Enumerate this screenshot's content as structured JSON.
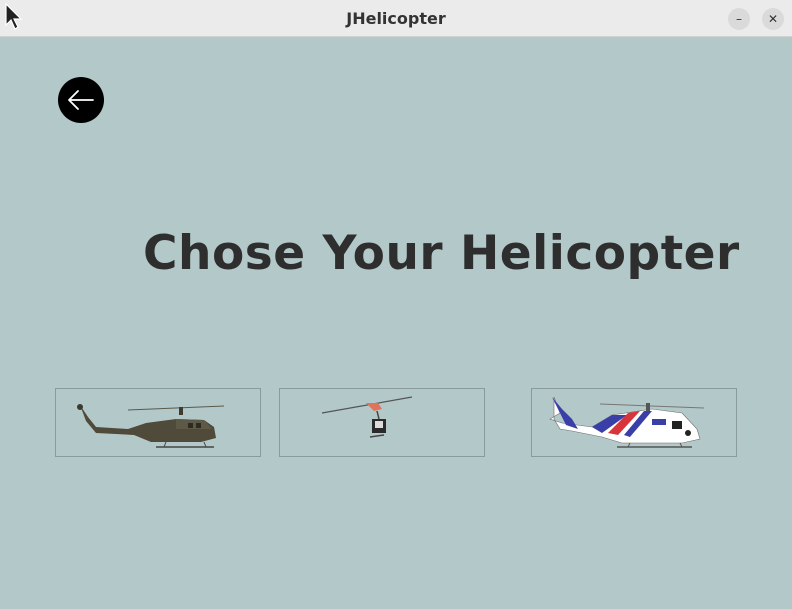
{
  "window": {
    "title": "JHelicopter",
    "minimize_glyph": "–",
    "close_glyph": "✕"
  },
  "back_button": {
    "icon": "arrow-left-icon"
  },
  "heading": "Chose Your Helicopter",
  "helicopters": [
    {
      "icon": "military-helicopter-icon",
      "colors": {
        "body": "#4f4a3a"
      }
    },
    {
      "icon": "small-helicopter-icon",
      "colors": {
        "body": "#2a2a2a",
        "accent": "#e0745a"
      }
    },
    {
      "icon": "medical-helicopter-icon",
      "colors": {
        "body": "#ffffff",
        "accent": "#3a3fa8",
        "stripe": "#d8343a"
      }
    }
  ]
}
